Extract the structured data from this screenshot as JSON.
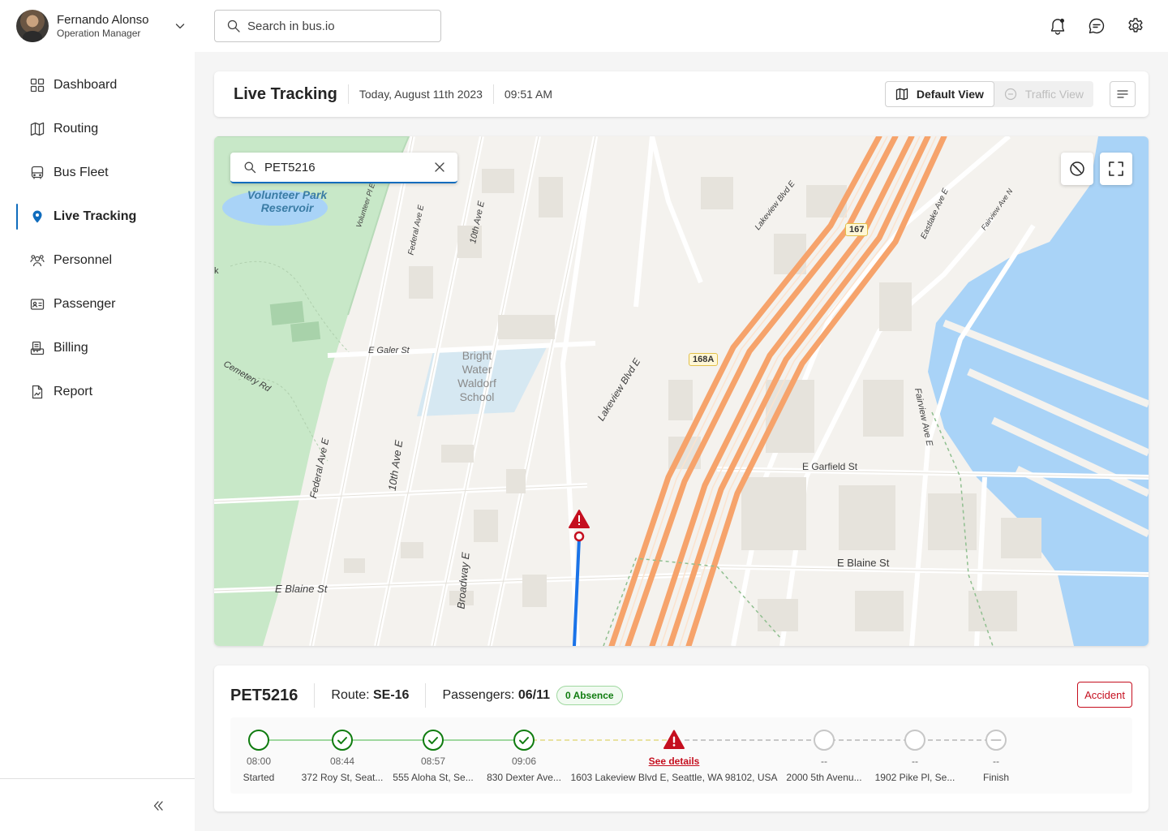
{
  "user": {
    "name": "Fernando Alonso",
    "role": "Operation Manager"
  },
  "search": {
    "placeholder": "Search in bus.io"
  },
  "nav": [
    {
      "label": "Dashboard",
      "icon": "grid-icon"
    },
    {
      "label": "Routing",
      "icon": "map-icon"
    },
    {
      "label": "Bus Fleet",
      "icon": "bus-icon"
    },
    {
      "label": "Live Tracking",
      "icon": "location-pin-icon",
      "active": true
    },
    {
      "label": "Personnel",
      "icon": "people-icon"
    },
    {
      "label": "Passenger",
      "icon": "id-card-icon"
    },
    {
      "label": "Billing",
      "icon": "receipt-icon"
    },
    {
      "label": "Report",
      "icon": "document-icon"
    }
  ],
  "header": {
    "title": "Live Tracking",
    "date": "Today, August 11th 2023",
    "time": "09:51 AM",
    "default_view": "Default View",
    "traffic_view": "Traffic View"
  },
  "map": {
    "search_value": "PET5216",
    "labels": {
      "park": "Volunteer Park Reservoir",
      "volunteer_pl": "Volunteer Pl E",
      "federal_top": "Federal Ave E",
      "tenth_top": "10th Ave E",
      "galer": "E Galer St",
      "cemetery": "Cemetery Rd",
      "school_1": "Bright",
      "school_2": "Water",
      "school_3": "Waldorf",
      "school_4": "School",
      "lakeview_top": "Lakeview Blvd E",
      "lakeview_mid": "Lakeview Blvd E",
      "eastlake": "Eastlake Ave E",
      "fairview_top": "Fairview Ave N",
      "fairview_mid": "Fairview Ave E",
      "garfield": "E Garfield St",
      "blaine_left": "E Blaine St",
      "blaine_right": "E Blaine St",
      "federal_bottom": "Federal Ave E",
      "tenth_bottom": "10th Ave E",
      "broadway": "Broadway E",
      "edge_k": "k"
    },
    "shields": {
      "s167": "167",
      "s168a": "168A"
    },
    "colors": {
      "route": "#1a73e8",
      "highway": "#f6a36b",
      "water": "#a9d3f7",
      "park": "#bfe3c0",
      "alert": "#c50f1f"
    }
  },
  "trip": {
    "id": "PET5216",
    "route_label": "Route:",
    "route_value": "SE-16",
    "passengers_label": "Passengers:",
    "passengers_value": "06/11",
    "absence": "0 Absence",
    "accident": "Accident",
    "stops": [
      {
        "time": "08:00",
        "address": "Started",
        "status": "start"
      },
      {
        "time": "08:44",
        "address": "372 Roy St, Seat...",
        "status": "done"
      },
      {
        "time": "08:57",
        "address": "555 Aloha St, Se...",
        "status": "done"
      },
      {
        "time": "09:06",
        "address": "830 Dexter Ave...",
        "status": "done"
      },
      {
        "time": "See details",
        "address": "1603 Lakeview Blvd E, Seattle, WA 98102, USA",
        "status": "alert"
      },
      {
        "time": "--",
        "address": "2000 5th Avenu...",
        "status": "todo"
      },
      {
        "time": "--",
        "address": "1902 Pike Pl, Se...",
        "status": "todo"
      },
      {
        "time": "--",
        "address": "Finish",
        "status": "finish"
      }
    ]
  }
}
